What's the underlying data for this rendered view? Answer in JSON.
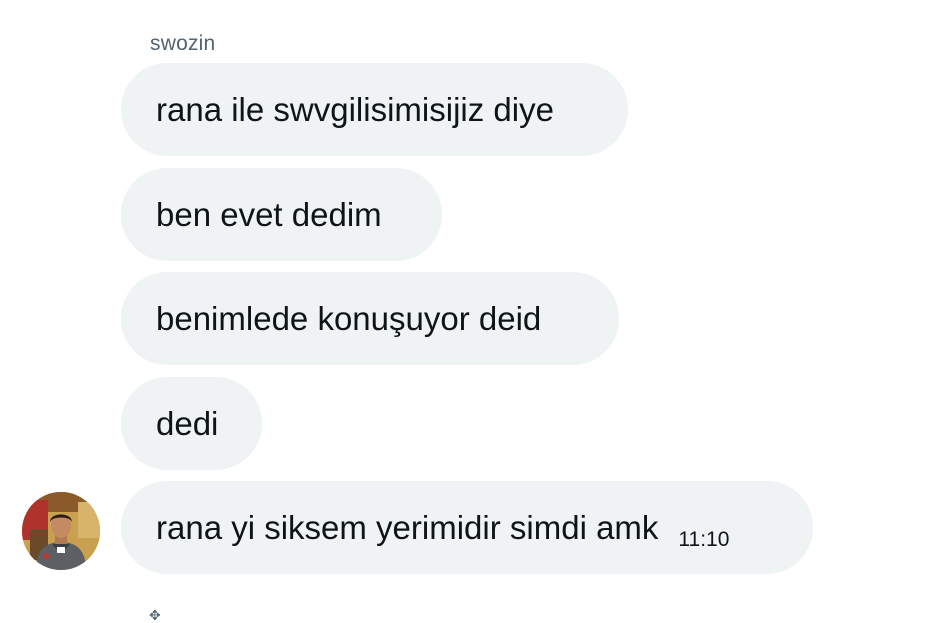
{
  "conversation": {
    "sender_name": "swozin",
    "messages": [
      {
        "text": "rana ile swvgilisimisijiz diye",
        "time": ""
      },
      {
        "text": "ben evet dedim",
        "time": ""
      },
      {
        "text": "benimlede konuşuyor deid",
        "time": ""
      },
      {
        "text": "dedi",
        "time": ""
      },
      {
        "text": "rana yi siksem yerimidir simdi amk",
        "time": "11:10"
      }
    ]
  },
  "colors": {
    "bubble_background": "#eff3f4",
    "text": "#0f1419",
    "secondary_text": "#536471"
  },
  "icons": {
    "avatar": "profile-avatar",
    "cursor": "move-cursor-icon"
  }
}
